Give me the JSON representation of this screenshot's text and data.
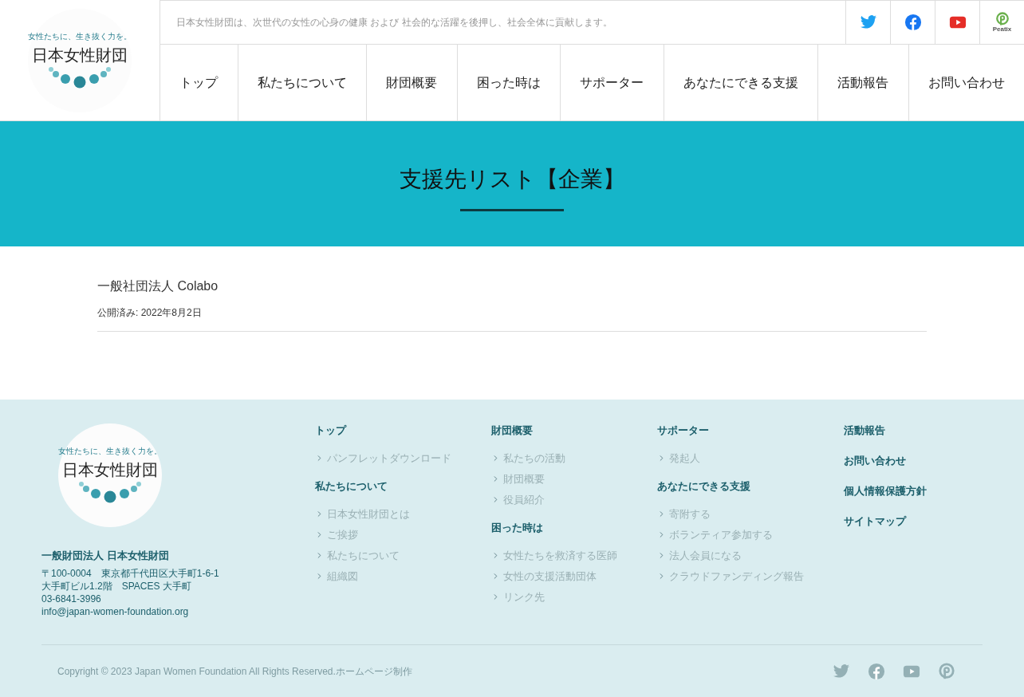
{
  "header": {
    "logo": {
      "tagline": "女性たちに、生き抜く力を。",
      "name": "日本女性財団"
    },
    "message": "日本女性財団は、次世代の女性の心身の健康 および 社会的な活躍を後押し、社会全体に貢献します。",
    "social": [
      {
        "kind": "twitter"
      },
      {
        "kind": "facebook"
      },
      {
        "kind": "youtube"
      },
      {
        "kind": "peatix",
        "label": "Peatix"
      }
    ],
    "nav": [
      "トップ",
      "私たちについて",
      "財団概要",
      "困った時は",
      "サポーター",
      "あなたにできる支援",
      "活動報告",
      "お問い合わせ"
    ]
  },
  "hero": {
    "title": "支援先リスト【企業】"
  },
  "post": {
    "title": "一般社団法人 Colabo",
    "date": "公開済み: 2022年8月2日"
  },
  "footer": {
    "logo": {
      "tagline": "女性たちに、生き抜く力を。",
      "name": "日本女性財団"
    },
    "org": "一般財団法人 日本女性財団",
    "address": [
      "〒100-0004　東京都千代田区大手町1-6-1",
      "大手町ビル1.2階　SPACES 大手町",
      "03-6841-3996",
      "info@japan-women-foundation.org"
    ],
    "columns": [
      [
        {
          "heading": "トップ",
          "items": [
            "パンフレットダウンロード"
          ]
        },
        {
          "heading": "私たちについて",
          "items": [
            "日本女性財団とは",
            "ご挨拶",
            "私たちについて",
            "組織図"
          ]
        }
      ],
      [
        {
          "heading": "財団概要",
          "items": [
            "私たちの活動",
            "財団概要",
            "役員紹介"
          ]
        },
        {
          "heading": "困った時は",
          "items": [
            "女性たちを救済する医師",
            "女性の支援活動団体",
            "リンク先"
          ]
        }
      ],
      [
        {
          "heading": "サポーター",
          "items": [
            "発起人"
          ]
        },
        {
          "heading": "あなたにできる支援",
          "items": [
            "寄附する",
            "ボランティア参加する",
            "法人会員になる",
            "クラウドファンディング報告"
          ]
        }
      ],
      [
        {
          "heading": "活動報告"
        },
        {
          "heading": "お問い合わせ"
        },
        {
          "heading": "個人情報保護方針"
        },
        {
          "heading": "サイトマップ"
        }
      ]
    ],
    "copyright": "Copyright © 2023 Japan Women Foundation All Rights Reserved.ホームページ制作",
    "social": [
      {
        "kind": "twitter"
      },
      {
        "kind": "facebook"
      },
      {
        "kind": "youtube"
      },
      {
        "kind": "peatix"
      }
    ]
  }
}
